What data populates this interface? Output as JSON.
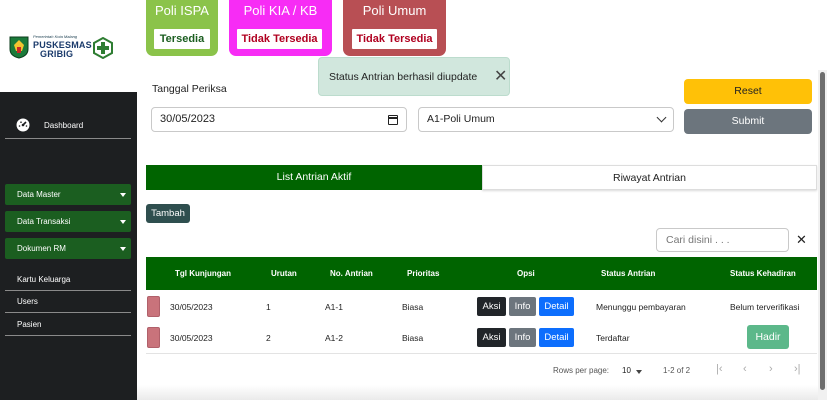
{
  "brand": {
    "small_text": "Pemerintah Kota Malang",
    "line1": "PUSKESMAS",
    "line2": "GRIBIG"
  },
  "sidebar": {
    "dashboard": "Dashboard",
    "dropdowns": [
      "Data Master",
      "Data Transaksi",
      "Dokumen RM"
    ],
    "sub_items": [
      "Kartu Keluarga",
      "Users",
      "Pasien"
    ]
  },
  "poli_status": [
    {
      "name": "Poli ISPA",
      "status": "Tersedia",
      "color": "#8bc34a",
      "status_color": "#1b5e20"
    },
    {
      "name": "Poli KIA / KB",
      "status": "Tidak Tersedia",
      "color": "#f72cf5",
      "status_color": "#b00020"
    },
    {
      "name": "Poli Umum",
      "status": "Tidak Tersedia",
      "color": "#b84f54",
      "status_color": "#b00020"
    }
  ],
  "toast": {
    "message": "Status Antrian berhasil diupdate"
  },
  "form": {
    "date_label": "Tanggal Periksa",
    "date_value": "30/05/2023",
    "poli_selected": "A1-Poli Umum",
    "reset_label": "Reset",
    "submit_label": "Submit"
  },
  "tabs": [
    "List Antrian Aktif",
    "Riwayat Antrian"
  ],
  "add_label": "Tambah",
  "search": {
    "placeholder": "Cari disini . . ."
  },
  "table": {
    "headers": [
      "Tgl Kunjungan",
      "Urutan",
      "No. Antrian",
      "Prioritas",
      "Opsi",
      "Status Antrian",
      "Status Kehadiran"
    ],
    "option_labels": {
      "aksi": "Aksi",
      "info": "Info",
      "detail": "Detail"
    },
    "rows": [
      {
        "tgl": "30/05/2023",
        "urutan": "1",
        "no": "A1-1",
        "prioritas": "Biasa",
        "status_antrian": "Menunggu pembayaran",
        "kehadiran": "Belum terverifikasi",
        "kehadiran_button": ""
      },
      {
        "tgl": "30/05/2023",
        "urutan": "2",
        "no": "A1-2",
        "prioritas": "Biasa",
        "status_antrian": "Terdaftar",
        "kehadiran": "",
        "kehadiran_button": "Hadir"
      }
    ]
  },
  "pagination": {
    "rows_label": "Rows per page:",
    "rows_value": "10",
    "range": "1-2 of 2"
  }
}
